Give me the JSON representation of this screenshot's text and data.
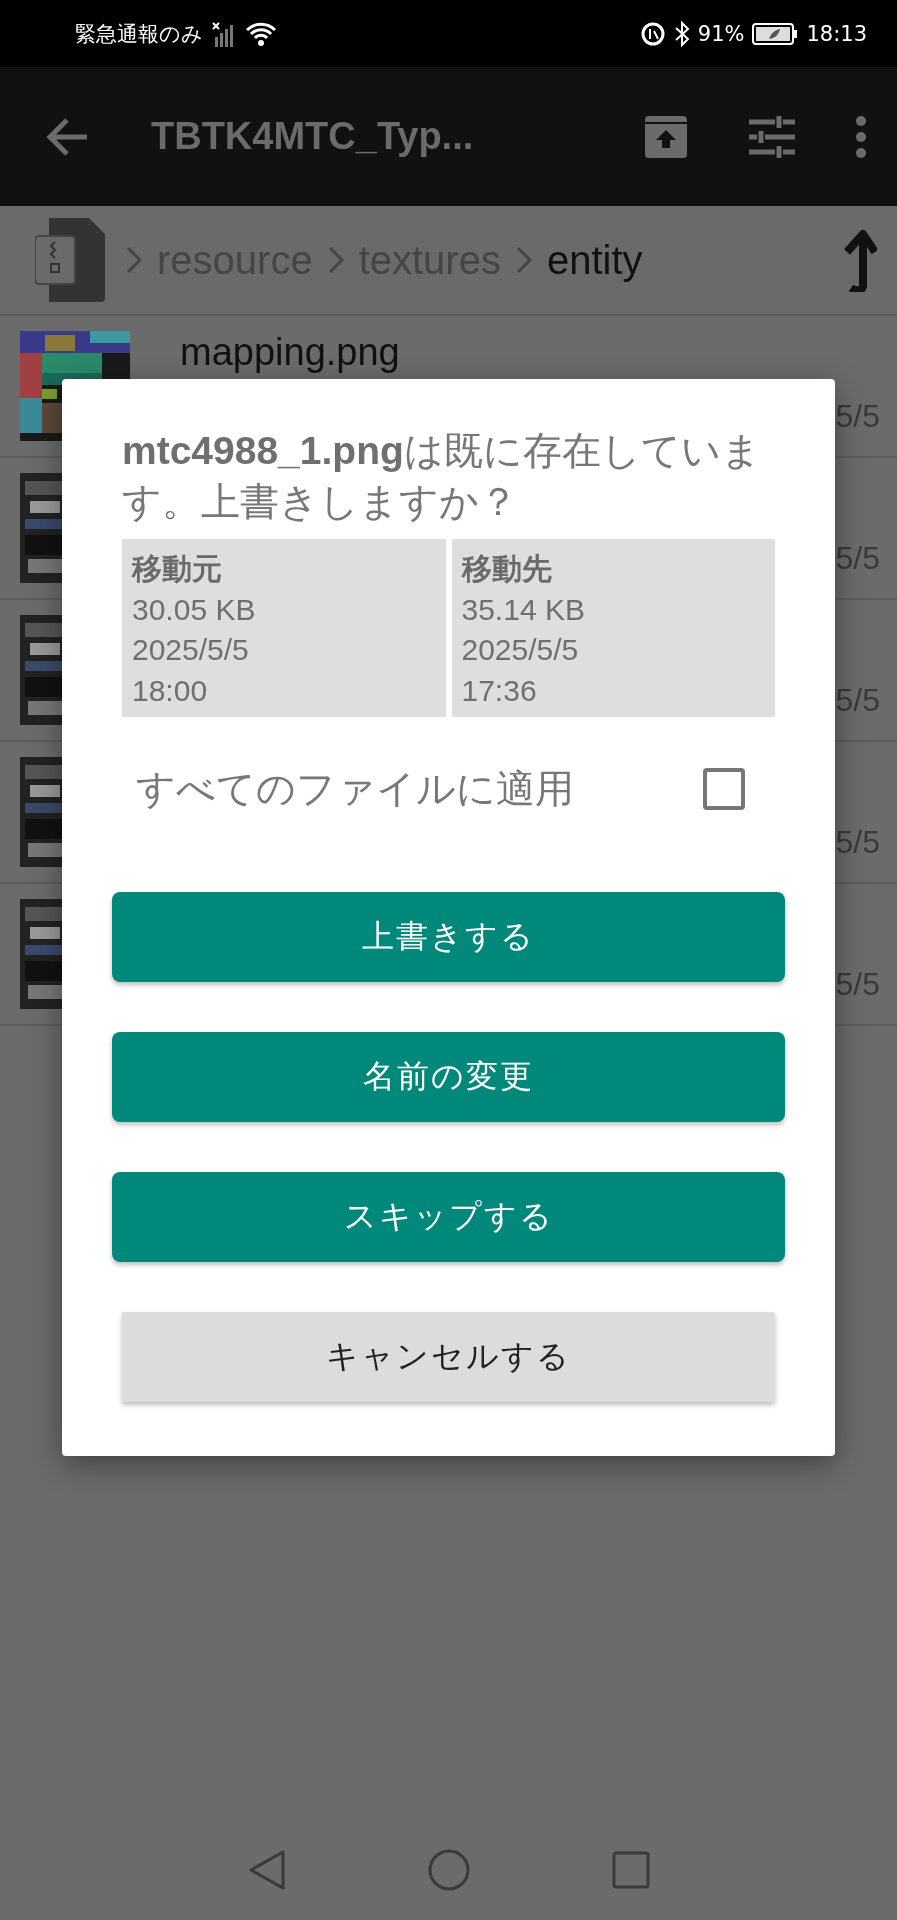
{
  "status_bar": {
    "carrier": "緊急通報のみ",
    "battery": "91%",
    "time": "18:13"
  },
  "toolbar": {
    "title": "TBTK4MTC_Typ..."
  },
  "breadcrumb": {
    "items": [
      {
        "label": "resource",
        "selected": false
      },
      {
        "label": "textures",
        "selected": false
      },
      {
        "label": "entity",
        "selected": true
      }
    ]
  },
  "files": [
    {
      "name": "mapping.png",
      "date": "5/5"
    },
    {
      "date": "5/5"
    },
    {
      "date": "5/5"
    },
    {
      "date": "5/5"
    },
    {
      "date": "5/5"
    }
  ],
  "dialog": {
    "message": "**mtc4988_1.png**は既に存在しています。上書きしますか？",
    "details": [
      {
        "heading": "移動元",
        "size": "30.05 KB",
        "date": "2025/5/5",
        "time": "18:00"
      },
      {
        "heading": "移動先",
        "size": "35.14 KB",
        "date": "2025/5/5",
        "time": "17:36"
      }
    ],
    "apply_all": {
      "label": "すべてのファイルに適用",
      "checked": false
    },
    "buttons": [
      {
        "label": "上書きする",
        "kind": "primary"
      },
      {
        "label": "名前の変更",
        "kind": "primary"
      },
      {
        "label": "スキップする",
        "kind": "primary"
      },
      {
        "label": "キャンセルする",
        "kind": "secondary"
      }
    ]
  }
}
